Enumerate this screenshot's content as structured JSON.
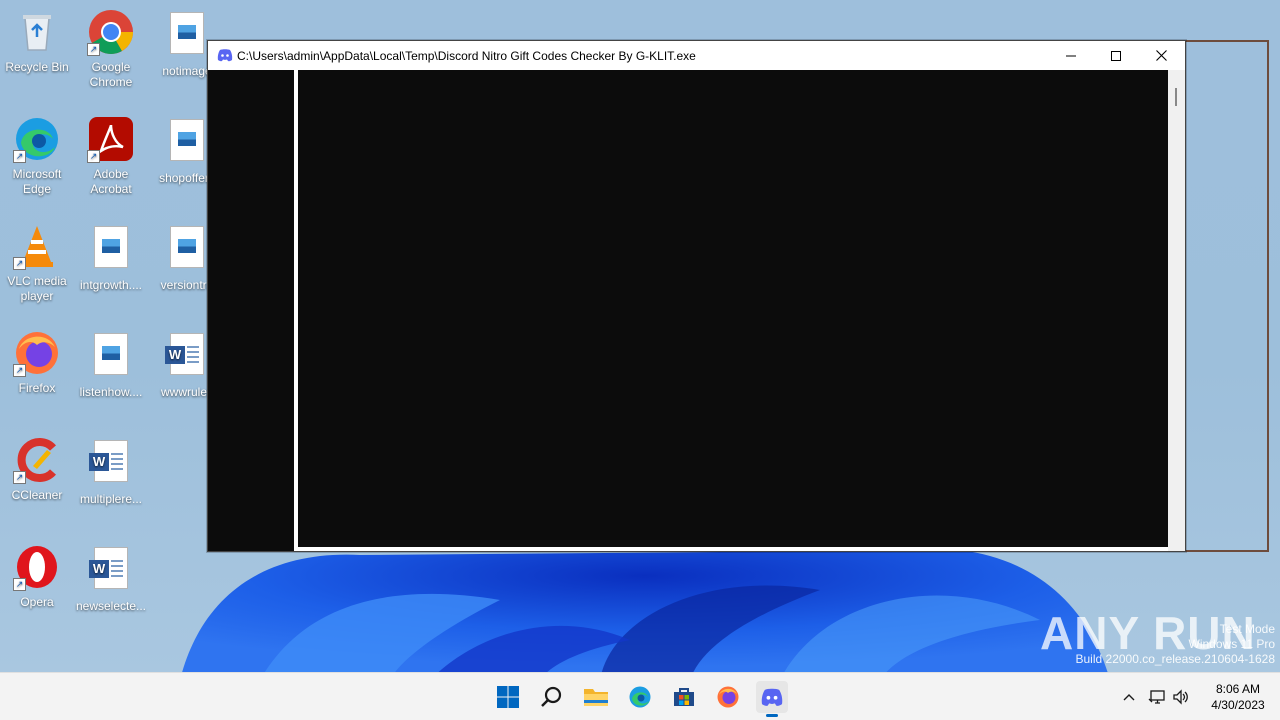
{
  "desktop": {
    "icons": [
      {
        "label": "Recycle Bin",
        "icon": "recycle-bin-icon"
      },
      {
        "label": "Google Chrome",
        "icon": "chrome-icon"
      },
      {
        "label": "notimage",
        "icon": "image-file-icon"
      },
      {
        "label": "Microsoft Edge",
        "icon": "edge-icon"
      },
      {
        "label": "Adobe Acrobat",
        "icon": "acrobat-icon"
      },
      {
        "label": "shopoffers",
        "icon": "image-file-icon"
      },
      {
        "label": "VLC media player",
        "icon": "vlc-icon"
      },
      {
        "label": "intgrowth....",
        "icon": "image-file-icon"
      },
      {
        "label": "versiontra",
        "icon": "image-file-icon"
      },
      {
        "label": "Firefox",
        "icon": "firefox-icon"
      },
      {
        "label": "listenhow....",
        "icon": "image-file-icon"
      },
      {
        "label": "wwwrules",
        "icon": "word-doc-icon"
      },
      {
        "label": "CCleaner",
        "icon": "ccleaner-icon"
      },
      {
        "label": "multiplere...",
        "icon": "word-doc-icon"
      },
      {
        "label": "Opera",
        "icon": "opera-icon"
      },
      {
        "label": "newselecte...",
        "icon": "word-doc-icon"
      }
    ]
  },
  "window": {
    "title": "C:\\Users\\admin\\AppData\\Local\\Temp\\Discord Nitro Gift Codes Checker By G-KLIT.exe",
    "minimize": "—",
    "maximize": "☐",
    "close": "✕"
  },
  "watermark": {
    "text": "ANY RUN",
    "test_mode": "Test Mode",
    "os": "Windows 11 Pro",
    "build": "Build 22000.co_release.210604-1628"
  },
  "taskbar": {
    "time": "8:06 AM",
    "date": "4/30/2023",
    "colors": {
      "accent": "#0067c0",
      "discord": "#5865f2"
    }
  }
}
